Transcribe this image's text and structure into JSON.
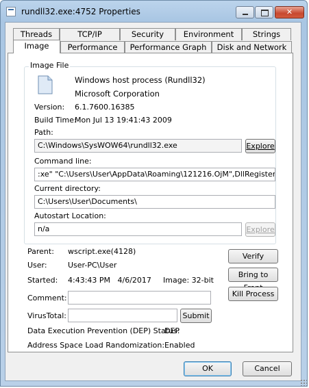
{
  "window": {
    "title": "rundll32.exe:4752 Properties"
  },
  "title_buttons": {
    "minimize": "",
    "maximize": "",
    "close": "✕"
  },
  "tabs_back": [
    "Threads",
    "TCP/IP",
    "Security",
    "Environment",
    "Strings"
  ],
  "tabs_front": [
    "Image",
    "Performance",
    "Performance Graph",
    "Disk and Network"
  ],
  "active_tab": "Image",
  "image_file": {
    "group_label": "Image File",
    "description": "Windows host process (Rundll32)",
    "company": "Microsoft Corporation",
    "version_label": "Version:",
    "version": "6.1.7600.16385",
    "build_time_label": "Build Time:",
    "build_time": "Mon Jul 13 19:41:43 2009",
    "path_label": "Path:",
    "path": "C:\\Windows\\SysWOW64\\rundll32.exe",
    "explore_label": "Explore",
    "command_line_label": "Command line:",
    "command_line": ":xe\" \"C:\\Users\\User\\AppData\\Roaming\\121216.OjM\",DllRegisterServer",
    "current_directory_label": "Current directory:",
    "current_directory": "C:\\Users\\User\\Documents\\",
    "autostart_label": "Autostart Location:",
    "autostart": "n/a",
    "explore2_label": "Explore"
  },
  "process": {
    "parent_label": "Parent:",
    "parent": "wscript.exe(4128)",
    "user_label": "User:",
    "user": "User-PC\\User",
    "started_label": "Started:",
    "started": "4:43:43 PM   4/6/2017",
    "image_label": "Image: 32-bit",
    "comment_label": "Comment:",
    "comment": "",
    "virustotal_label": "VirusTotal:",
    "virustotal": "",
    "submit_label": "Submit",
    "dep_label": "Data Execution Prevention (DEP) Status:",
    "dep": "DEP",
    "aslr_label": "Address Space Load Randomization:",
    "aslr": "Enabled"
  },
  "side_buttons": {
    "verify": "Verify",
    "bring_to_front": "Bring to Front",
    "kill_process": "Kill Process"
  },
  "footer": {
    "ok": "OK",
    "cancel": "Cancel"
  }
}
